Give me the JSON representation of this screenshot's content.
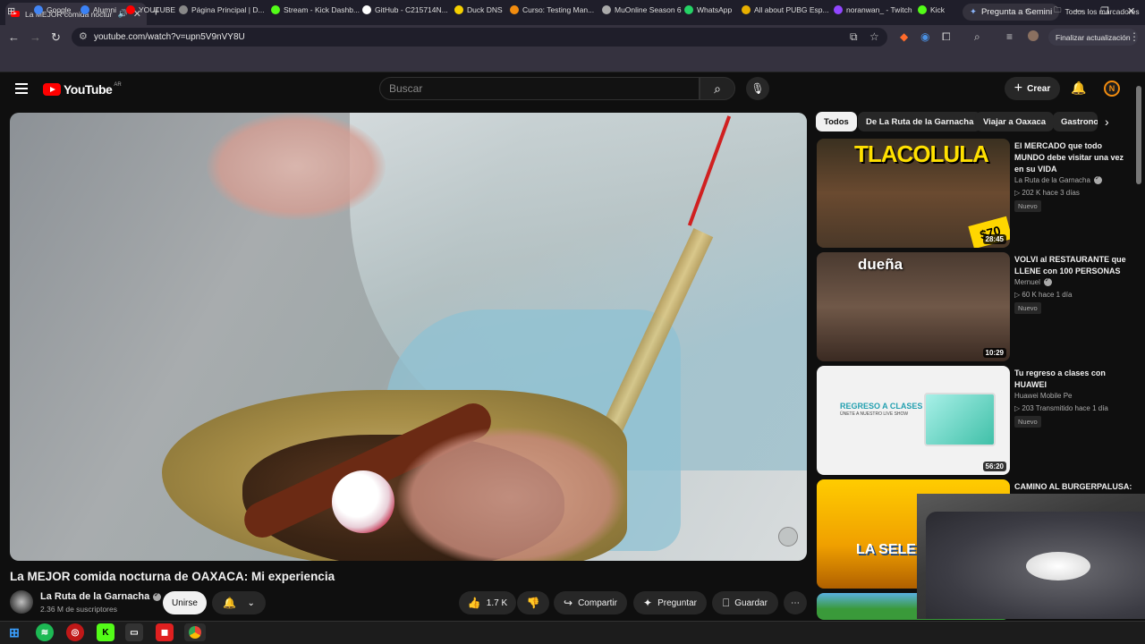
{
  "browser": {
    "tab_title": "La MEJOR comida nocturna",
    "gemini_label": "Pregunta a Gemini",
    "url": "youtube.com/watch?v=upn5V9nVY8U",
    "update_label": "Finalizar actualización",
    "bookmarks": [
      {
        "label": "Google",
        "icon": "google-icon",
        "color": "#4285f4"
      },
      {
        "label": "Alumni",
        "icon": "x-icon",
        "color": "#3b82f6"
      },
      {
        "label": "YOUTUBE",
        "icon": "youtube-icon",
        "color": "#ff0000"
      },
      {
        "label": "Página Principal | D...",
        "icon": "sa-icon",
        "color": "#888888"
      },
      {
        "label": "Stream - Kick Dashb...",
        "icon": "kick-icon",
        "color": "#53fc18"
      },
      {
        "label": "GitHub - C215714N...",
        "icon": "github-icon",
        "color": "#ffffff"
      },
      {
        "label": "Duck DNS",
        "icon": "duck-icon",
        "color": "#f5d000"
      },
      {
        "label": "Curso: Testing Man...",
        "icon": "course-icon",
        "color": "#f28c0f"
      },
      {
        "label": "MuOnline Season 6",
        "icon": "mu-icon",
        "color": "#aaaaaa"
      },
      {
        "label": "WhatsApp",
        "icon": "whatsapp-icon",
        "color": "#25d366"
      },
      {
        "label": "All about PUBG Esp...",
        "icon": "pubg-icon",
        "color": "#e8b000"
      },
      {
        "label": "noranwan_ - Twitch",
        "icon": "twitch-icon",
        "color": "#9146ff"
      },
      {
        "label": "Kick",
        "icon": "kick-icon",
        "color": "#53fc18"
      }
    ],
    "all_bookmarks": "Todos los marcadores"
  },
  "youtube": {
    "logo_text": "YouTube",
    "country": "AR",
    "search_placeholder": "Buscar",
    "create_label": "Crear",
    "chips": [
      "Todos",
      "De La Ruta de la Garnacha",
      "Viajar a Oaxaca",
      "Gastrono"
    ],
    "video": {
      "title": "La MEJOR comida nocturna de OAXACA: Mi experiencia",
      "channel": "La Ruta de la Garnacha",
      "subscribers": "2.36 M de suscriptores",
      "join_label": "Unirse",
      "likes": "1.7 K",
      "share_label": "Compartir",
      "ask_label": "Preguntar",
      "save_label": "Guardar"
    },
    "recommendations": [
      {
        "title": "El MERCADO que todo MUNDO debe visitar una vez en su VIDA",
        "channel": "La Ruta de la Garnacha",
        "verified": true,
        "meta": "202 K hace 3 días",
        "badge": "Nuevo",
        "duration": "28:45",
        "thumb_text": "TLACOLULA",
        "price": "$70"
      },
      {
        "title": "VOLVI al RESTAURANTE que LLENE con 100 PERSONAS",
        "channel": "Mernuel",
        "verified": true,
        "meta": "60 K hace 1 día",
        "badge": "Nuevo",
        "duration": "10:29",
        "thumb_text": "dueña"
      },
      {
        "title": "Tu regreso a clases con HUAWEI",
        "channel": "Huawei Mobile Pe",
        "verified": false,
        "meta": "203 Transmitido hace 1 día",
        "badge": "Nuevo",
        "duration": "56:20",
        "thumb_text": "REGRESO A CLASES",
        "thumb_sub": "ÚNETE A NUESTRO LIVE SHOW"
      },
      {
        "title": "CAMINO AL BURGERPALUSA:",
        "thumb_text": "LA SELE"
      }
    ]
  }
}
